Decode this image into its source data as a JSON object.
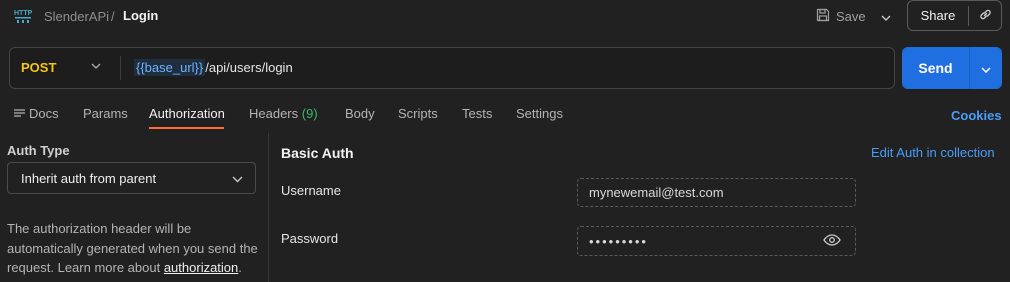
{
  "header": {
    "icon": "http-icon",
    "breadcrumb_parent": "SlenderAPi",
    "breadcrumb_separator": "/",
    "breadcrumb_current": "Login",
    "save_label": "Save",
    "share_label": "Share"
  },
  "request": {
    "method": "POST",
    "url_variable": "{{base_url}}",
    "url_path": "/api/users/login",
    "send_label": "Send"
  },
  "tabs": [
    {
      "label": "Docs"
    },
    {
      "label": "Params"
    },
    {
      "label": "Authorization"
    },
    {
      "label": "Headers",
      "count": "(9)"
    },
    {
      "label": "Body"
    },
    {
      "label": "Scripts"
    },
    {
      "label": "Tests"
    },
    {
      "label": "Settings"
    }
  ],
  "active_tab": "Authorization",
  "cookies_label": "Cookies",
  "auth": {
    "type_label": "Auth Type",
    "type_value": "Inherit auth from parent",
    "help_text": "The authorization header will be automatically generated when you send the request. Learn more about ",
    "help_link": "authorization",
    "help_suffix": "."
  },
  "basic_auth": {
    "title": "Basic Auth",
    "edit_link": "Edit Auth in collection",
    "username_label": "Username",
    "username_value": "mynewemail@test.com",
    "password_label": "Password",
    "password_value": "•••••••••"
  },
  "colors": {
    "method": "#f5c518",
    "accent_blue": "#1f6fe0",
    "link_blue": "#4a9df8",
    "active_tab_underline": "#ff6c37",
    "count_green": "#3fb86a"
  }
}
